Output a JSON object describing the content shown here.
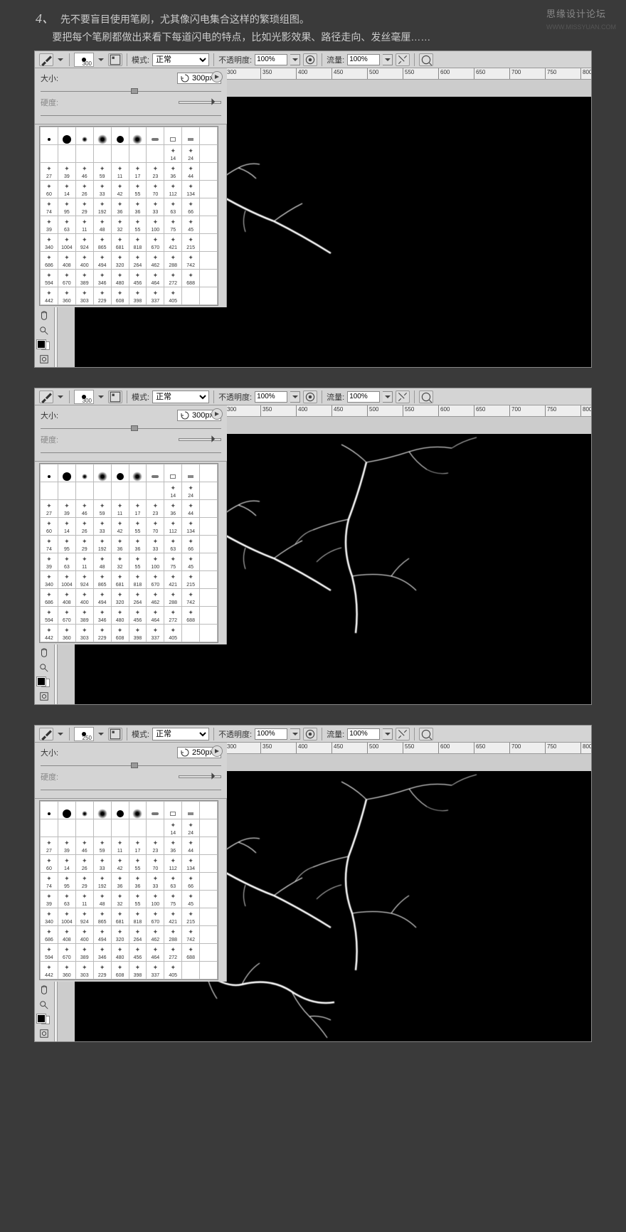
{
  "header": {
    "num": "4、",
    "line1": "先不要盲目使用笔刷，尤其像闪电集合这样的繁琐组图。",
    "line2": "要把每个笔刷都做出来看下每道闪电的特点，比如光影效果、路径走向、发丝毫厘……"
  },
  "watermark": {
    "title": "思缘设计论坛",
    "sub": "WWW.MISSYUAN.COM"
  },
  "toolbar": {
    "mode_lbl": "模式:",
    "mode_val": "正常",
    "opacity_lbl": "不透明度:",
    "opacity_val": "100%",
    "flow_lbl": "流量:",
    "flow_val": "100%"
  },
  "brushes": {
    "size_lbl": "大小:",
    "hardness_lbl": "硬度:"
  },
  "panels": [
    {
      "brush_num": "300",
      "size_val": "300px",
      "lightning": [
        true,
        false,
        false
      ]
    },
    {
      "brush_num": "300",
      "size_val": "300px",
      "lightning": [
        true,
        true,
        false
      ]
    },
    {
      "brush_num": "250",
      "size_val": "250px",
      "lightning": [
        true,
        true,
        true
      ]
    }
  ],
  "ruler_ticks": [
    "300",
    "350",
    "400",
    "450",
    "500",
    "550",
    "600",
    "650",
    "700",
    "750",
    "800"
  ],
  "brush_rows": [
    [
      "",
      "",
      "",
      "",
      "",
      "",
      "",
      "",
      "",
      ""
    ],
    [
      "",
      "",
      "",
      "",
      "",
      "",
      "",
      "14",
      "24",
      ""
    ],
    [
      "27",
      "39",
      "46",
      "59",
      "11",
      "17",
      "23",
      "36",
      "44",
      ""
    ],
    [
      "60",
      "14",
      "26",
      "33",
      "42",
      "55",
      "70",
      "112",
      "134",
      ""
    ],
    [
      "74",
      "95",
      "29",
      "192",
      "36",
      "36",
      "33",
      "63",
      "66",
      ""
    ],
    [
      "39",
      "63",
      "11",
      "48",
      "32",
      "55",
      "100",
      "75",
      "45",
      ""
    ],
    [
      "340",
      "1004",
      "924",
      "865",
      "681",
      "818",
      "670",
      "421",
      "215",
      ""
    ],
    [
      "686",
      "408",
      "400",
      "494",
      "320",
      "264",
      "462",
      "288",
      "742",
      ""
    ],
    [
      "594",
      "670",
      "389",
      "346",
      "480",
      "456",
      "464",
      "272",
      "688",
      ""
    ],
    [
      "442",
      "360",
      "303",
      "229",
      "608",
      "398",
      "337",
      "405",
      "",
      ""
    ]
  ]
}
